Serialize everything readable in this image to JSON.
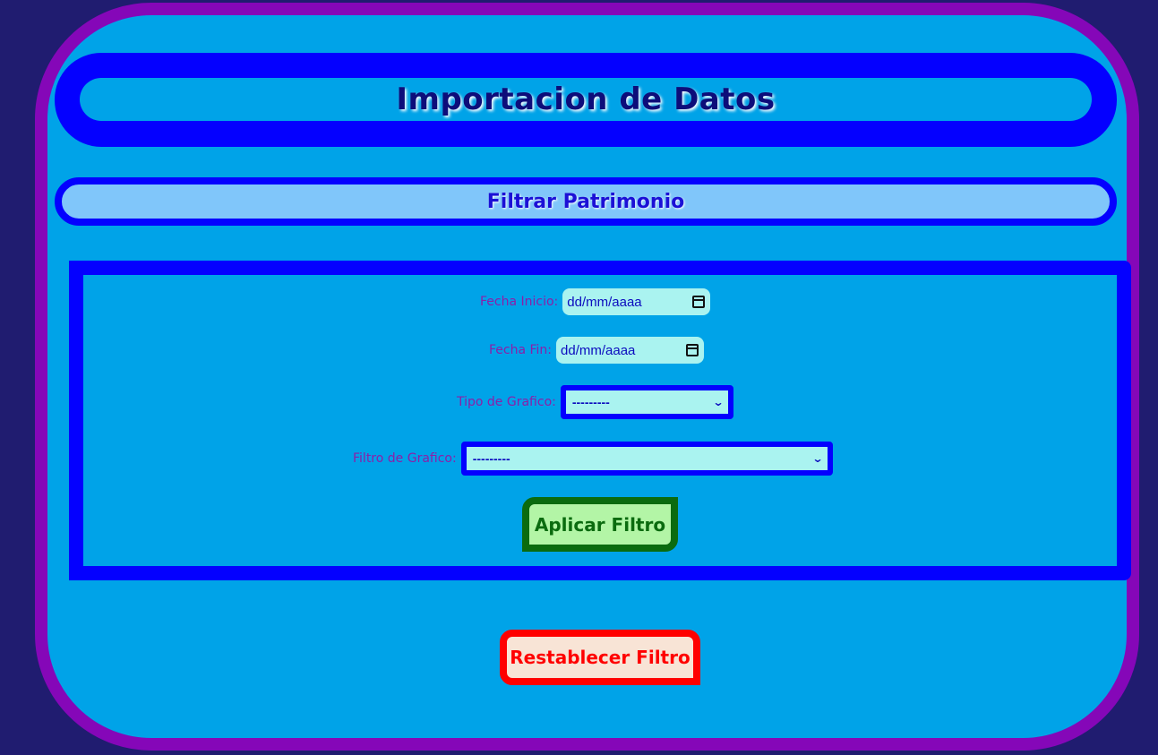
{
  "header": {
    "title": "Importacion de Datos"
  },
  "section": {
    "title": "Filtrar Patrimonio"
  },
  "form": {
    "fecha_inicio": {
      "label": "Fecha Inicio:",
      "value": "dd/mm/aaaa",
      "icon": "calendar-icon"
    },
    "fecha_fin": {
      "label": "Fecha Fin:",
      "value": "dd/mm/aaaa",
      "icon": "calendar-icon"
    },
    "tipo_grafico": {
      "label": "Tipo de Grafico:",
      "selected": "---------",
      "icon": "chevron-down-icon"
    },
    "filtro_grafico": {
      "label": "Filtro de Grafico:",
      "selected": "---------",
      "icon": "chevron-down-icon"
    },
    "apply_label": "Aplicar Filtro"
  },
  "reset_label": "Restablecer Filtro",
  "colors": {
    "page_background": "#201c70",
    "frame_border": "#8507b8",
    "frame_fill": "#00a3e8",
    "primary_blue": "#0400ff",
    "apply_green": "#0b6b0f",
    "reset_red": "#ff0000"
  }
}
